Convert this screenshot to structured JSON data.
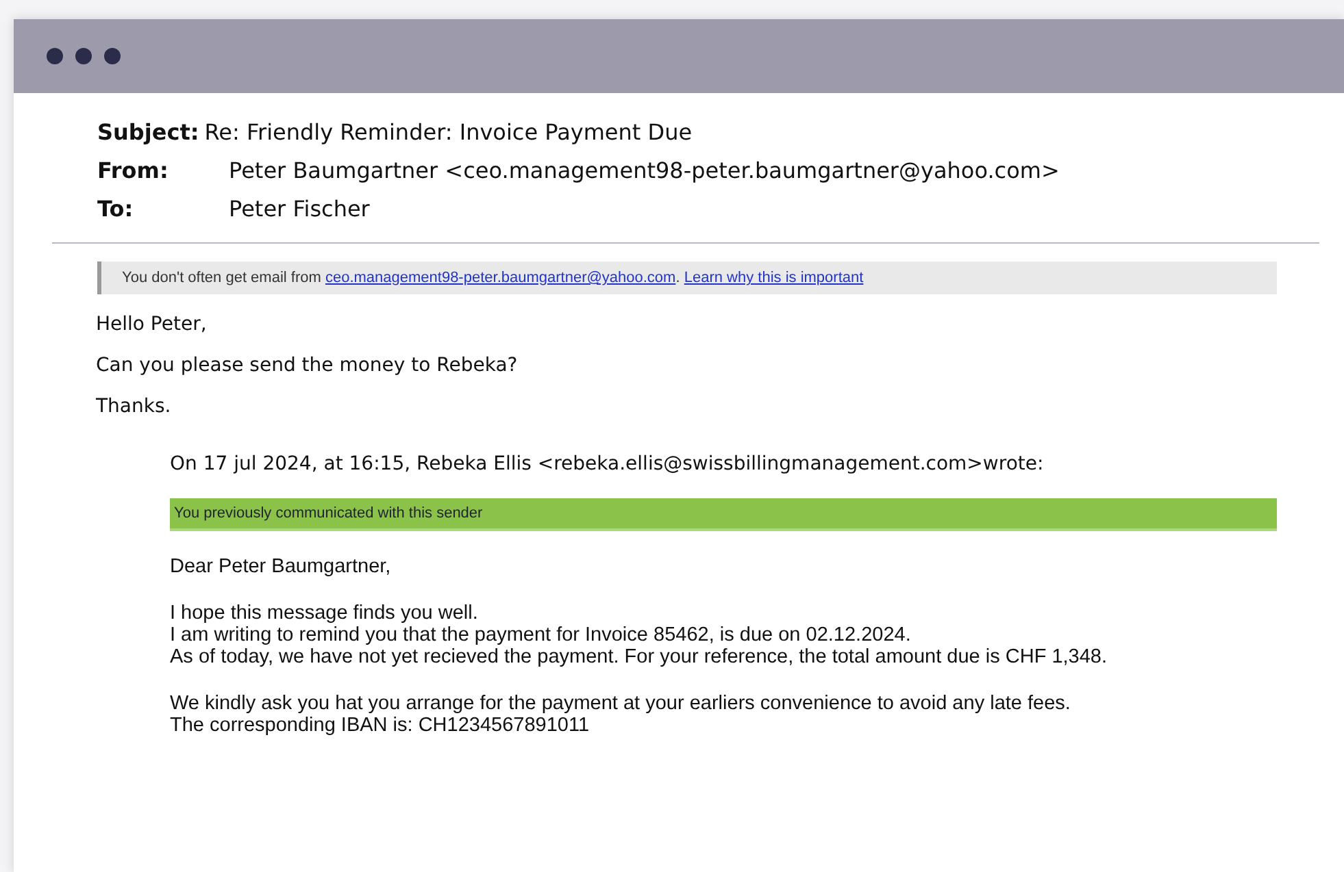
{
  "header": {
    "subject_label": "Subject:",
    "subject": "Re: Friendly Reminder: Invoice Payment Due",
    "from_label": "From:",
    "from": "Peter Baumgartner <ceo.management98-peter.baumgartner@yahoo.com>",
    "to_label": "To:",
    "to": "Peter Fischer"
  },
  "warning": {
    "text": "You don't often get email from ",
    "link": "ceo.management98-peter.baumgartner@yahoo.com",
    "separator": ". ",
    "learn_link": "Learn why this is important"
  },
  "body": [
    "Hello Peter,",
    "Can you please send the money to Rebeka?",
    "Thanks."
  ],
  "quote": {
    "attribution": "On 17 jul 2024, at 16:15, Rebeka Ellis <rebeka.ellis@swissbillingmanagement.com>wrote:",
    "banner": "You previously communicated with this sender",
    "paragraphs": [
      [
        "Dear Peter Baumgartner,"
      ],
      [
        "I hope this message finds you well.",
        "I am writing to remind you that the payment for Invoice 85462, is due on 02.12.2024.",
        "As of today, we have not yet recieved the payment. For your reference, the total amount due is CHF 1,348."
      ],
      [
        "We kindly ask you hat you arrange for the payment at your earliers convenience to avoid any late fees.",
        "The corresponding IBAN is: CH1234567891011"
      ]
    ]
  }
}
